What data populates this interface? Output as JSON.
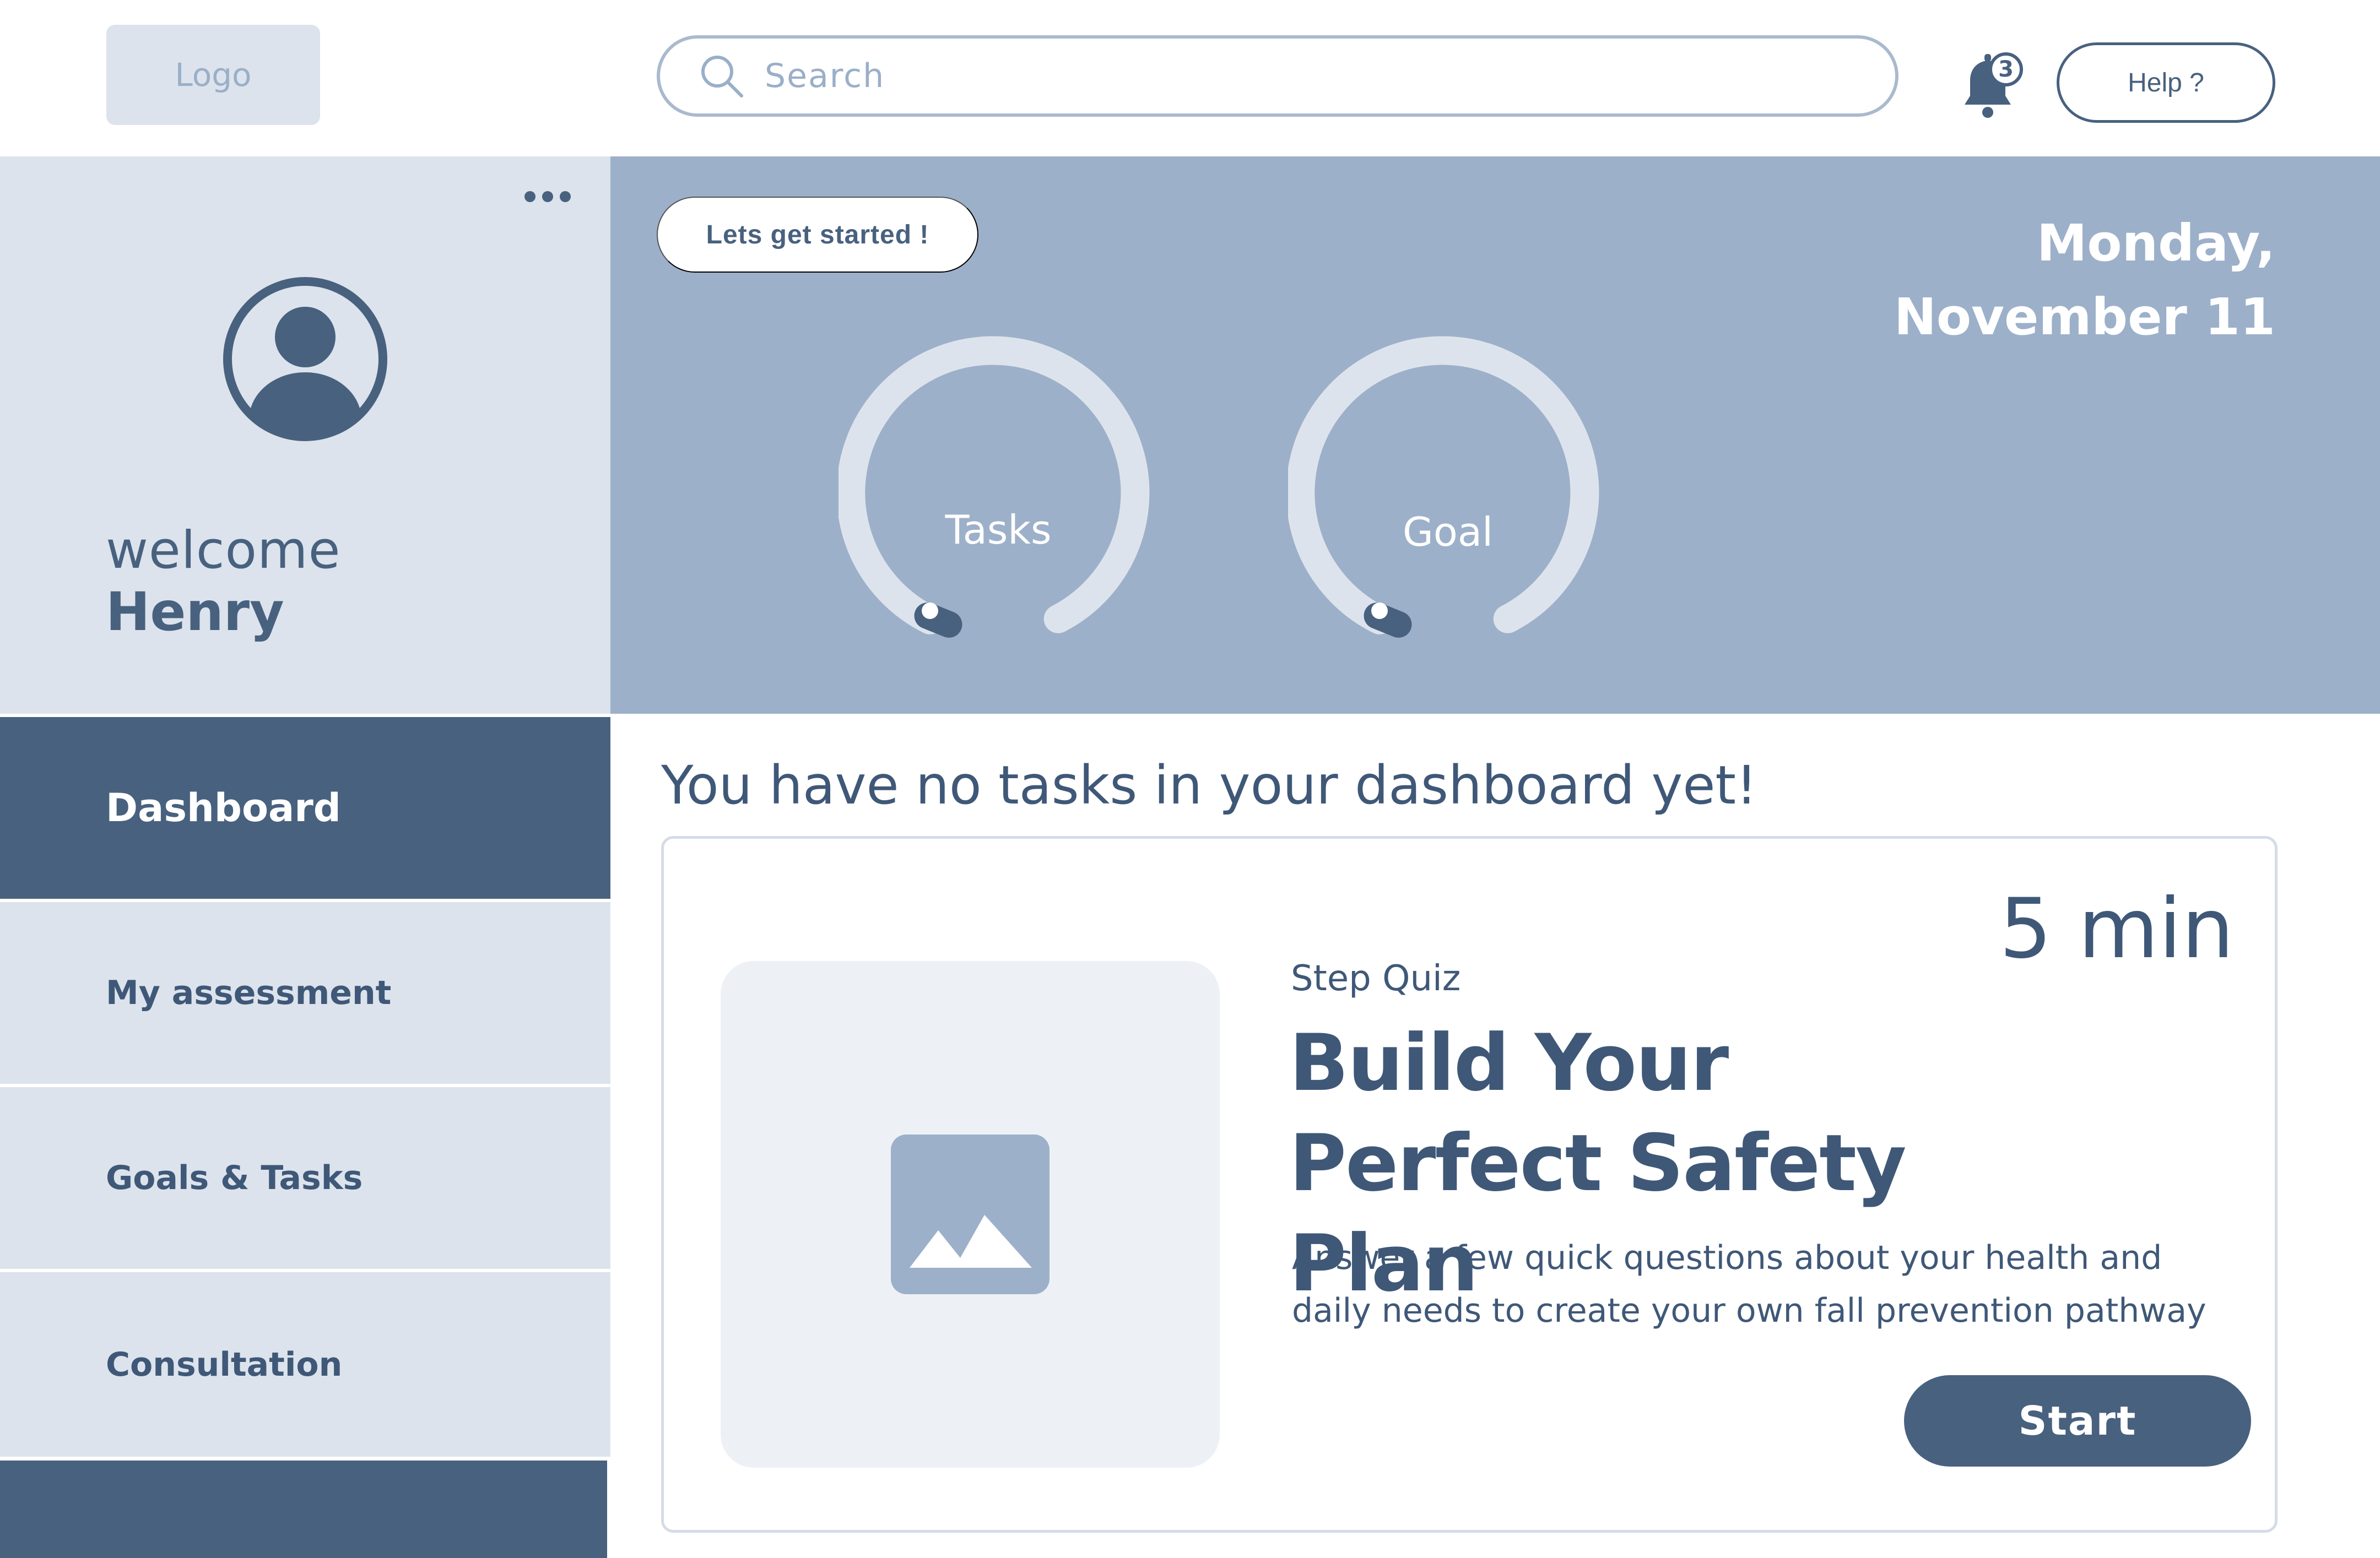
{
  "header": {
    "logo_text": "Logo",
    "search_placeholder": "Search",
    "notification_count": "3",
    "help_label": "Help ?"
  },
  "profile": {
    "greeting": "welcome",
    "user_name": "Henry"
  },
  "sidebar": {
    "items": [
      {
        "label": "Dashboard",
        "active": true
      },
      {
        "label": "My assessment",
        "active": false
      },
      {
        "label": "Goals & Tasks",
        "active": false
      },
      {
        "label": "Consultation",
        "active": false
      }
    ]
  },
  "banner": {
    "get_started_label": "Lets get started !",
    "date_line1": "Monday,",
    "date_line2": "November 11",
    "gauges": [
      {
        "label": "Tasks",
        "progress": 0
      },
      {
        "label": "Goal",
        "progress": 0
      }
    ]
  },
  "main": {
    "empty_message": "You have no tasks in your dashboard yet!",
    "card": {
      "duration": "5 min",
      "type_label": "Step Quiz",
      "title": "Build Your Perfect Safety Plan",
      "description": "Answer a few quick questions about your health and daily needs to create your own fall prevention pathway",
      "cta_label": "Start"
    }
  },
  "colors": {
    "primary": "#48617F",
    "panel": "#DCE3EC",
    "banner": "#9CB0C9"
  }
}
